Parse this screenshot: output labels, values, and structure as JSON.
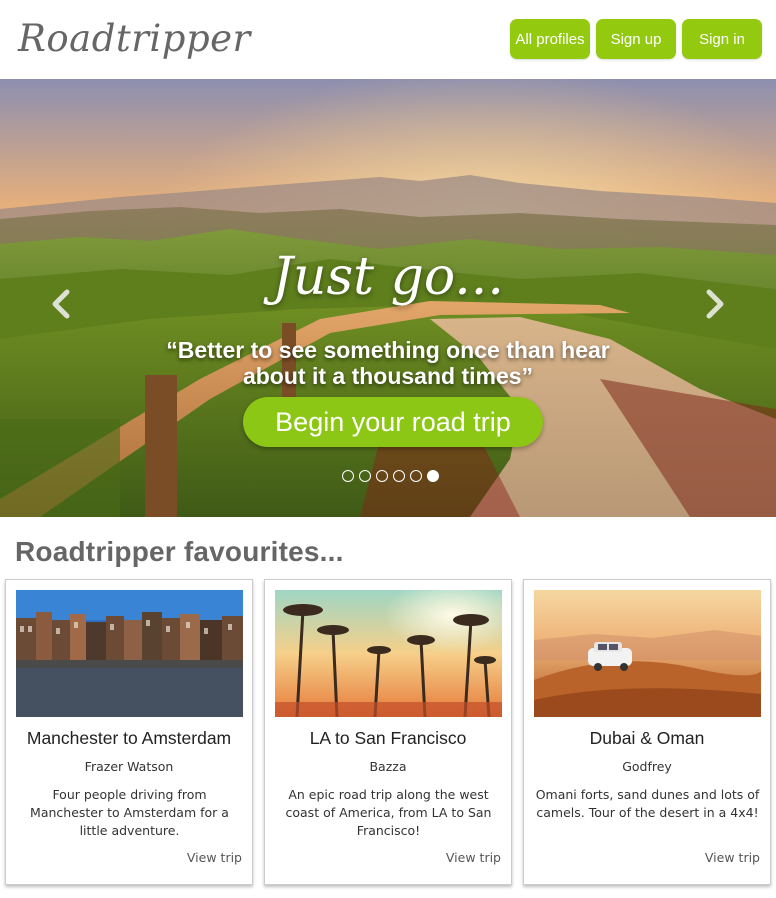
{
  "header": {
    "logo": "Roadtripper",
    "nav": [
      "All profiles",
      "Sign up",
      "Sign in"
    ]
  },
  "hero": {
    "tagline": "Just go...",
    "quote": "“Better to see something once than hear about it a thousand times”",
    "cta": "Begin your road trip",
    "slides_total": 6,
    "active_slide": 6
  },
  "favourites": {
    "title": "Roadtripper favourites...",
    "cards": [
      {
        "title": "Manchester to Amsterdam",
        "author": "Frazer Watson",
        "description": "Four people driving from Manchester to Amsterdam for a little adventure.",
        "link": "View trip"
      },
      {
        "title": "LA to San Francisco",
        "author": "Bazza",
        "description": "An epic road trip along the west coast of America, from LA to San Francisco!",
        "link": "View trip"
      },
      {
        "title": "Dubai & Oman",
        "author": "Godfrey",
        "description": "Omani forts, sand dunes and lots of camels. Tour of the desert in a 4x4!",
        "link": "View trip"
      }
    ]
  },
  "colors": {
    "accent": "#93c90f",
    "heading": "#666666"
  }
}
